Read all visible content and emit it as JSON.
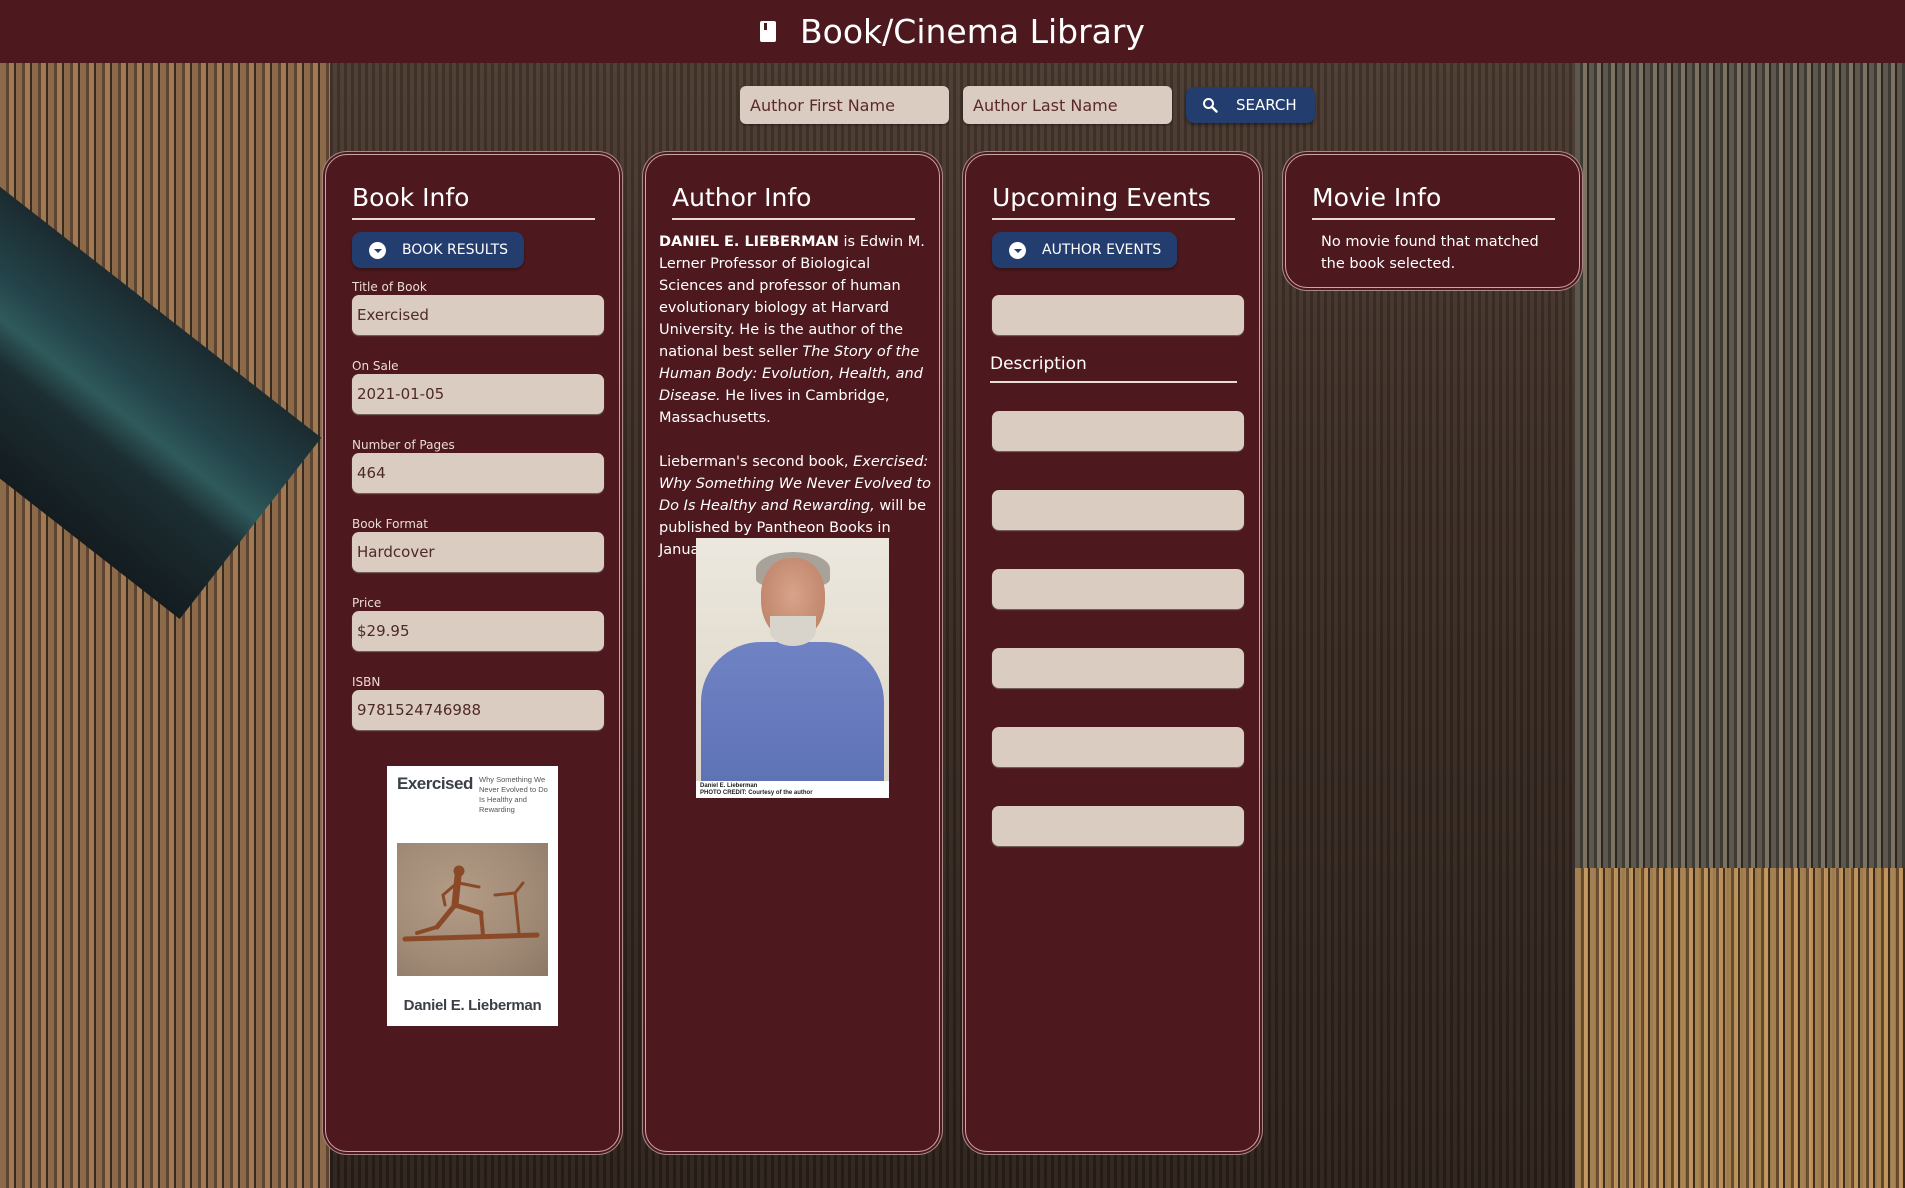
{
  "header": {
    "icon": "book-icon",
    "title": "Book/Cinema Library"
  },
  "search": {
    "first_name_placeholder": "Author First Name",
    "last_name_placeholder": "Author Last Name",
    "first_name_value": "",
    "last_name_value": "",
    "button_icon": "search-icon",
    "button_label": "SEARCH"
  },
  "book_info": {
    "title": "Book Info",
    "results_button": "BOOK RESULTS",
    "fields": [
      {
        "label": "Title of Book",
        "value": "Exercised"
      },
      {
        "label": "On Sale",
        "value": "2021-01-05"
      },
      {
        "label": "Number of Pages",
        "value": "464"
      },
      {
        "label": "Book Format",
        "value": "Hardcover"
      },
      {
        "label": "Price",
        "value": "$29.95"
      },
      {
        "label": "ISBN",
        "value": "9781524746988"
      }
    ],
    "cover": {
      "title": "Exercised",
      "subtitle": "Why Something We Never Evolved to Do Is Healthy and Rewarding",
      "author": "Daniel E. Lieberman"
    }
  },
  "author_info": {
    "title": "Author Info",
    "bio_p1": {
      "name_bold": "DANIEL E. LIEBERMAN",
      "text1": " is Edwin M. Lerner Professor of Biological Sciences and professor of human evolutionary biology at Harvard University. He is the author of the national best seller ",
      "italic": "The Story of the Human Body: Evolution, Health, and Disease.",
      "text2": " He lives in Cambridge, Massachusetts."
    },
    "bio_p2": {
      "text1": "Lieberman's second book, ",
      "italic": "Exercised: Why Something We Never Evolved to Do Is Healthy and Rewarding,",
      "text2": " will be published by Pantheon Books in January 2021."
    },
    "photo": {
      "caption_line1": "Daniel E. Lieberman",
      "caption_line2": "PHOTO CREDIT: Courtesy of the author"
    }
  },
  "events": {
    "title": "Upcoming Events",
    "events_button": "AUTHOR EVENTS",
    "event_field": "",
    "description_heading": "Description",
    "description_fields": [
      "",
      "",
      "",
      "",
      "",
      ""
    ]
  },
  "movie_info": {
    "title": "Movie Info",
    "message": "No movie found that matched the book selected."
  },
  "colors": {
    "header_bg": "#4e191e",
    "panel_bg": "#4e191e",
    "button_blue": "#233d6e",
    "field_bg": "#dbccc1"
  }
}
